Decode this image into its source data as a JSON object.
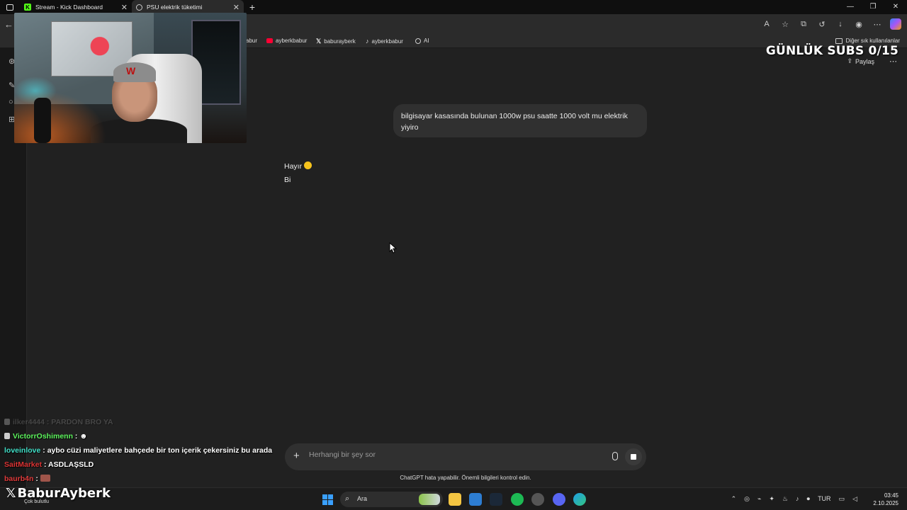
{
  "browser": {
    "tabs": [
      {
        "label": "Stream - Kick Dashboard",
        "icon": "kick-icon",
        "active": false
      },
      {
        "label": "PSU elektrik tüketimi",
        "icon": "chatgpt-icon",
        "active": true
      }
    ],
    "bookmarks": [
      {
        "label": "abur",
        "icon": "bookmark-icon"
      },
      {
        "label": "ayberkbabur",
        "icon": "youtube-icon"
      },
      {
        "label": "baburayberk",
        "icon": "x-icon"
      },
      {
        "label": "ayberkbabur",
        "icon": "tiktok-icon"
      },
      {
        "label": "AI",
        "icon": "chatgpt-icon"
      }
    ],
    "other_bookmarks": "Diğer sık kullanılanlar"
  },
  "overlay": {
    "subs_goal": "GÜNLÜK SUBS 0/15",
    "brand_name": "BaburAyberk",
    "brand_sub": "Çok bulutlu"
  },
  "chatgpt": {
    "share_label": "Paylaş",
    "user_message": "bilgisayar kasasında bulunan 1000w psu saatte 1000 volt mu elektrik yiyiro",
    "assistant_line1": "Hayır",
    "assistant_line2": "Bi",
    "composer_placeholder": "Herhangi bir şey sor",
    "disclaimer": "ChatGPT hata yapabilir. Önemli bilgileri kontrol edin."
  },
  "stream_chat": [
    {
      "user": "ilker4444",
      "text": " : PARDON BRO YA",
      "faded": true
    },
    {
      "user": "VictorrOshimenn",
      "text": " : ",
      "faded": false
    },
    {
      "user": "loveinlove",
      "text": " : aybo cüzi maliyetlere bahçede bir ton içerik çekersiniz bu arada",
      "faded": false
    },
    {
      "user": "SaitMarket",
      "text": " : ASDLAŞSLD",
      "faded": false
    },
    {
      "user": "baurb4n",
      "text": " : ",
      "faded": false
    }
  ],
  "taskbar": {
    "search_label": "Ara",
    "language": "TUR",
    "time": "03:45",
    "date": "2.10.2025"
  }
}
